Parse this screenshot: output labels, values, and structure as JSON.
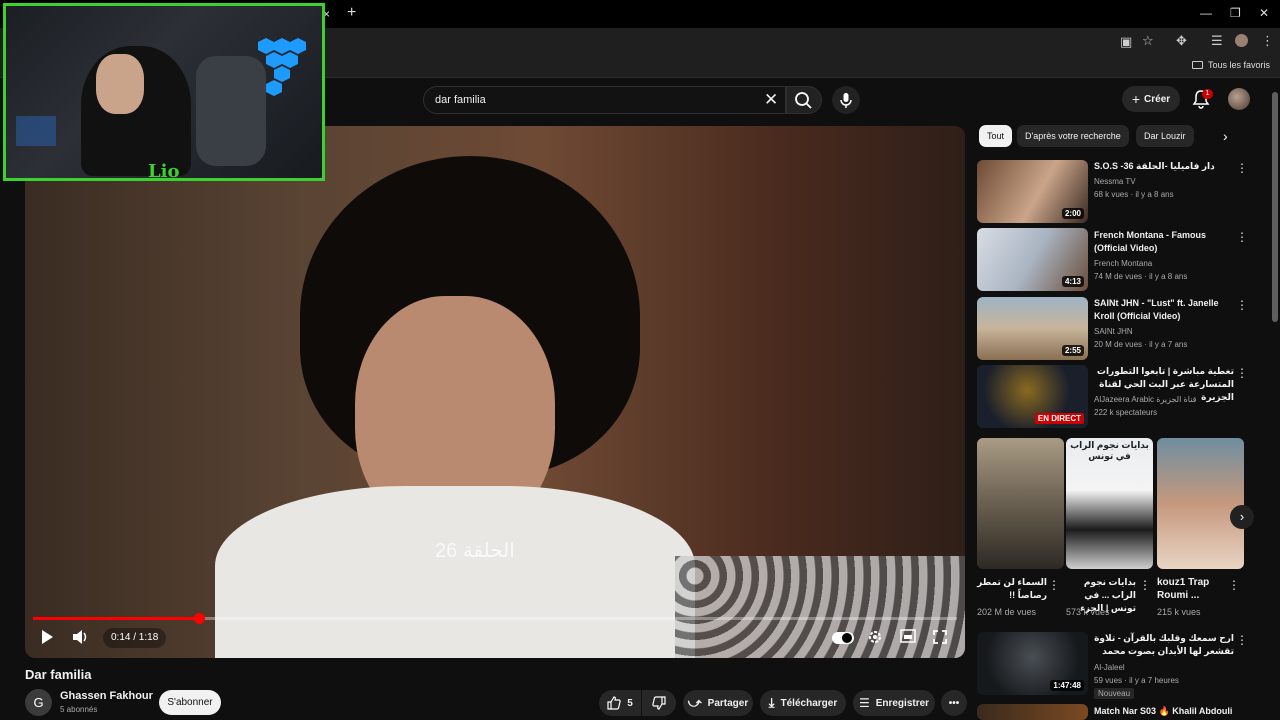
{
  "browser": {
    "bookmark_label": "Tous les favoris",
    "tab_close": "×",
    "new_tab": "+"
  },
  "header": {
    "search_value": "dar familia",
    "create_label": "Créer",
    "notification_count": "1"
  },
  "player": {
    "time": "0:14 / 1:18",
    "progress_fraction": 0.18,
    "caption_overlay": "الحلقة 26"
  },
  "video": {
    "title": "Dar familia",
    "channel_initial": "G",
    "channel_name": "Ghassen Fakhour",
    "subscribers": "5 abonnés",
    "subscribe_label": "S'abonner",
    "like_count": "5",
    "share_label": "Partager",
    "download_label": "Télécharger",
    "save_label": "Enregistrer"
  },
  "sidebar": {
    "chips": [
      "Tout",
      "D'après votre recherche",
      "Dar Louzir"
    ],
    "videos": [
      {
        "title": "S.O.S -36 دار فاميليا -الحلقة",
        "channel": "Nessma TV",
        "meta": "68 k vues · il y a 8 ans",
        "duration": "2:00"
      },
      {
        "title": "French Montana - Famous (Official Video)",
        "channel": "French Montana",
        "meta": "74 M de vues · il y a 8 ans",
        "duration": "4:13"
      },
      {
        "title": "SAINt JHN - \"Lust\" ft. Janelle Kroll (Official Video)",
        "channel": "SAINt JHN",
        "meta": "20 M de vues · il y a 7 ans",
        "duration": "2:55"
      },
      {
        "title": "تغطية مباشرة | تابعوا التطورات المتسارعة عبر البث الحي لقناة الجزيرة",
        "channel": "AlJazeera Arabic قناة الجزيرة",
        "meta": "222 k spectateurs",
        "duration": "EN DIRECT"
      }
    ],
    "shorts": [
      {
        "title": "السماء لن تمطر رصاصاً !!",
        "views": "202 M de vues",
        "overlay": ""
      },
      {
        "title": "بدايات نجوم الراب ... في تونس | الجزء",
        "views": "573 k vues",
        "overlay": "بدايات نجوم الراب في تونس"
      },
      {
        "title": "kouz1 Trap Roumi ...",
        "views": "215 k vues",
        "overlay": ""
      }
    ],
    "more_videos": [
      {
        "title": "ارح سمعك وقلبك بالقرآن - تلاوة تقشعر لها الأبدان بصوت محمد هشام | Mohamed",
        "channel": "Al-Jaleel",
        "meta": "59 vues · il y a 7 heures",
        "duration": "1:47:48",
        "badge": "Nouveau"
      },
      {
        "title": "Match Nar S03 🔥 Khalil Abdouli",
        "channel": "",
        "meta": "",
        "duration": "",
        "badge": ""
      }
    ]
  },
  "colors": {
    "accent_red": "#ff0000",
    "webcam_border": "#3bd12e",
    "background": "#0f0f0f"
  }
}
